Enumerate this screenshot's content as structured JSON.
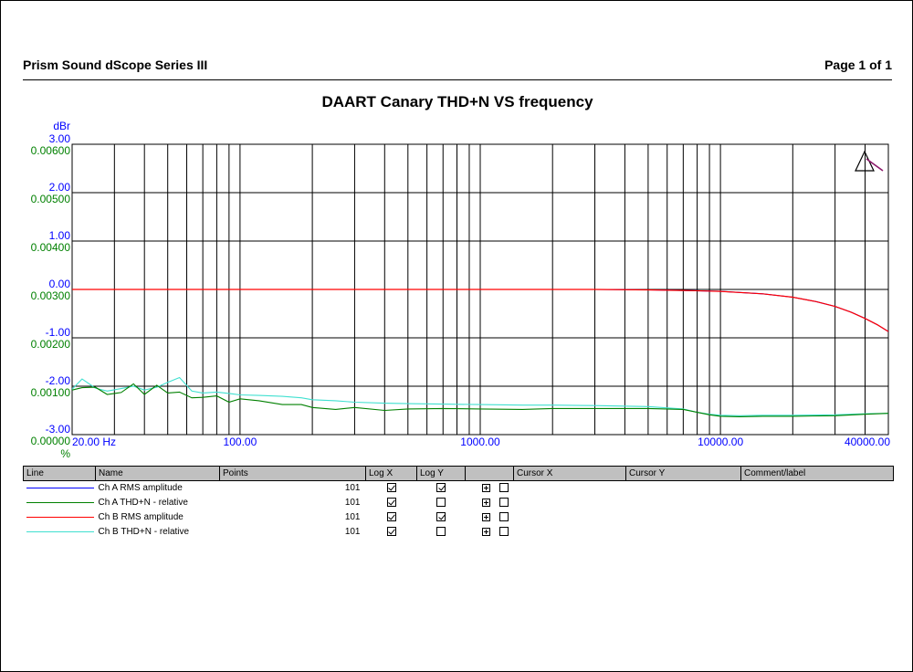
{
  "header": {
    "left": "Prism Sound dScope Series III",
    "right": "Page 1 of 1"
  },
  "chart_data": {
    "type": "line",
    "title": "DAART Canary THD+N VS frequency",
    "x_axis": {
      "scale": "log",
      "range": [
        20,
        50000
      ],
      "ticks": [
        "20.00 Hz",
        "100.00",
        "1000.00",
        "10000.00",
        "40000.00"
      ],
      "tick_values": [
        20,
        100,
        1000,
        10000,
        40000
      ]
    },
    "y_left_primary": {
      "unit": "dBr",
      "range": [
        -3,
        3
      ],
      "ticks": [
        "3.00",
        "2.00",
        "1.00",
        "0.00",
        "-1.00",
        "-2.00",
        "-3.00"
      ],
      "tick_values": [
        3,
        2,
        1,
        0,
        -1,
        -2,
        -3
      ],
      "color": "#0000ff"
    },
    "y_left_secondary": {
      "unit": "%",
      "range": [
        0,
        0.006
      ],
      "ticks": [
        "0.00600",
        "0.00500",
        "0.00400",
        "0.00300",
        "0.00200",
        "0.00100",
        "0.00000"
      ],
      "tick_values": [
        0.006,
        0.005,
        0.004,
        0.003,
        0.002,
        0.001,
        0
      ],
      "color": "#008000"
    },
    "grid": true,
    "series": [
      {
        "name": "Ch A RMS amplitude",
        "axis": "dBr",
        "color": "#0000ff",
        "x": [
          20,
          100,
          1000,
          3000,
          5000,
          7000,
          10000,
          15000,
          20000,
          25000,
          30000,
          35000,
          40000,
          45000,
          50000
        ],
        "y": [
          0,
          0,
          0,
          0,
          -0.01,
          -0.02,
          -0.04,
          -0.09,
          -0.16,
          -0.25,
          -0.35,
          -0.47,
          -0.6,
          -0.73,
          -0.87
        ]
      },
      {
        "name": "Ch A THD+N - relative",
        "axis": "%",
        "color": "#008000",
        "x": [
          20,
          22,
          25,
          28,
          32,
          36,
          40,
          45,
          50,
          56,
          63,
          70,
          80,
          90,
          100,
          120,
          150,
          180,
          200,
          250,
          300,
          400,
          500,
          700,
          1000,
          1500,
          2000,
          3000,
          5000,
          7000,
          8000,
          9000,
          10000,
          12000,
          15000,
          20000,
          30000,
          40000,
          50000
        ],
        "y": [
          0.00092,
          0.00097,
          0.00098,
          0.00083,
          0.00087,
          0.00105,
          0.00083,
          0.00102,
          0.00086,
          0.00088,
          0.00076,
          0.00077,
          0.0008,
          0.00067,
          0.00074,
          0.0007,
          0.00062,
          0.00062,
          0.00056,
          0.00052,
          0.00056,
          0.0005,
          0.00053,
          0.00054,
          0.00053,
          0.00052,
          0.00054,
          0.00054,
          0.00054,
          0.00052,
          0.00046,
          0.00041,
          0.00038,
          0.00037,
          0.00038,
          0.00038,
          0.00039,
          0.00042,
          0.00044
        ]
      },
      {
        "name": "Ch B  RMS amplitude",
        "axis": "dBr",
        "color": "#ff0000",
        "x": [
          20,
          100,
          1000,
          3000,
          5000,
          7000,
          10000,
          15000,
          20000,
          25000,
          30000,
          35000,
          40000,
          45000,
          50000
        ],
        "y": [
          0,
          0,
          0,
          0,
          -0.01,
          -0.02,
          -0.04,
          -0.09,
          -0.16,
          -0.25,
          -0.35,
          -0.47,
          -0.6,
          -0.73,
          -0.87
        ]
      },
      {
        "name": "Ch B THD+N - relative",
        "axis": "%",
        "color": "#40e0d0",
        "x": [
          20,
          22,
          25,
          28,
          32,
          36,
          40,
          45,
          50,
          56,
          63,
          70,
          80,
          90,
          100,
          120,
          150,
          180,
          200,
          250,
          300,
          400,
          500,
          700,
          1000,
          1500,
          2000,
          3000,
          5000,
          7000,
          8000,
          9000,
          10000,
          12000,
          15000,
          20000,
          30000,
          40000,
          50000
        ],
        "y": [
          0.00094,
          0.00115,
          0.00096,
          0.0009,
          0.00095,
          0.001,
          0.00092,
          0.00098,
          0.00108,
          0.00118,
          0.0009,
          0.00086,
          0.00088,
          0.00085,
          0.00082,
          0.00081,
          0.00079,
          0.00076,
          0.00072,
          0.0007,
          0.00067,
          0.00065,
          0.00064,
          0.00063,
          0.00062,
          0.00061,
          0.00061,
          0.0006,
          0.00058,
          0.00053,
          0.00046,
          0.00042,
          0.0004,
          0.00039,
          0.0004,
          0.0004,
          0.00041,
          0.00043,
          0.00044
        ]
      }
    ]
  },
  "legend_table": {
    "columns": [
      "Line",
      "Name",
      "Points",
      "Log X",
      "Log Y",
      "",
      "Cursor X",
      "Cursor Y",
      "Comment/label"
    ],
    "rows": [
      {
        "color": "#0000ff",
        "name": "Ch A RMS amplitude",
        "points": "101",
        "log_x": true,
        "log_y": true,
        "cursor": false
      },
      {
        "color": "#008000",
        "name": "Ch A THD+N - relative",
        "points": "101",
        "log_x": true,
        "log_y": false,
        "cursor": false
      },
      {
        "color": "#ff0000",
        "name": "Ch B  RMS amplitude",
        "points": "101",
        "log_x": true,
        "log_y": true,
        "cursor": false
      },
      {
        "color": "#40e0d0",
        "name": "Ch B THD+N - relative",
        "points": "101",
        "log_x": true,
        "log_y": false,
        "cursor": false
      }
    ]
  }
}
